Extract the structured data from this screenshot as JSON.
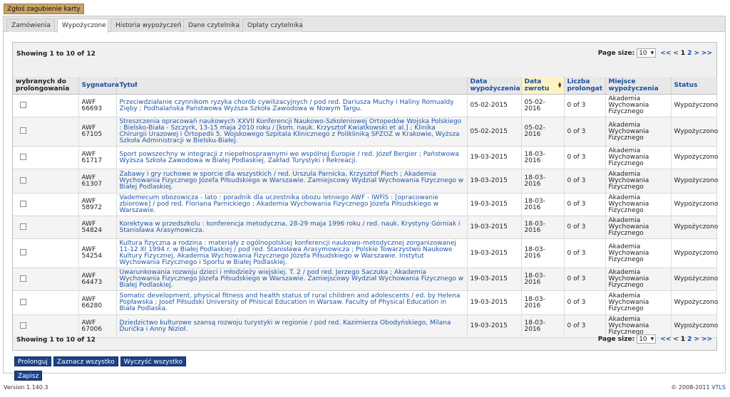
{
  "lost_card_label": "Zgłoś zagubienie karty",
  "tabs": [
    {
      "label": "Zamówienia"
    },
    {
      "label": "Wypożyczone"
    },
    {
      "label": "Historia wypożyczeń"
    },
    {
      "label": "Dane czytelnika"
    },
    {
      "label": "Opłaty czytelnika"
    }
  ],
  "active_tab": "Wypożyczone",
  "pager": {
    "showing": "Showing 1 to 10 of 12",
    "page_size_label": "Page size:",
    "page_size": "10",
    "first": "<<",
    "prev": "<",
    "page1": "1",
    "page2": "2",
    "next": ">",
    "last": ">>"
  },
  "columns": {
    "select": "wybranych do prolongowania",
    "signature": "Sygnatura",
    "title": "Tytuł",
    "loan_date": "Data wypożyczenia",
    "due_date": "Data zwrotu",
    "renewals": "Liczba prolongat",
    "location": "Miejsce wypożyczenia",
    "status": "Status"
  },
  "rows": [
    {
      "signature": "AWF 66693",
      "title": "Przeciwdziałanie czynnikom ryzyka chorób cywilizacyjnych / pod red. Dariusza Muchy i Haliny Romualdy Zięby ; Podhalańska Państwowa Wyższa Szkoła Zawodowa w Nowym Targu.",
      "loan_date": "05-02-2015",
      "due_date": "05-02-2016",
      "renewals": "0 of 3",
      "location": "Akademia Wychowania Fizycznego",
      "status": "Wypożyczono"
    },
    {
      "signature": "AWF 67105",
      "title": "Streszczenia opracowań naukowych XXVII Konferencji Naukowo-Szkoleniowej Ortopedów Wojska Polskiego : Bielsko-Biała - Szczyrk, 13-15 maja 2010 roku / [kom. nauk. Krzysztof Kwiatkowski et al.] ; Klinika Chirurgii Urazowej i Ortopedii 5. Wojskowego Szpitala Klinicznego z Polikliniką SPZOZ w Krakowie, Wyższa Szkoła Administracji w Bielsku-Białej.",
      "loan_date": "05-02-2015",
      "due_date": "05-02-2016",
      "renewals": "0 of 3",
      "location": "Akademia Wychowania Fizycznego",
      "status": "Wypożyczono"
    },
    {
      "signature": "AWF 61717",
      "title": "Sport powszechny w integracji z niepełnosprawnymi we wspólnej Europie / red. Józef Bergier ; Państwowa Wyższa Szkoła Zawodowa w Białej Podlaskiej. Zakład Turystyki i Rekreacji.",
      "loan_date": "19-03-2015",
      "due_date": "18-03-2016",
      "renewals": "0 of 3",
      "location": "Akademia Wychowania Fizycznego",
      "status": "Wypożyczono"
    },
    {
      "signature": "AWF 61307",
      "title": "Zabawy i gry ruchowe w sporcie dla wszystkich / red. Urszula Parnicka, Krzysztof Piech ; Akademia Wychowania Fizycznego Józefa Piłsudskiego w Warszawie. Zamiejscowy Wydział Wychowania Fizycznego w Białej Podlaskiej.",
      "loan_date": "19-03-2015",
      "due_date": "18-03-2016",
      "renewals": "0 of 3",
      "location": "Akademia Wychowania Fizycznego",
      "status": "Wypożyczono"
    },
    {
      "signature": "AWF 58972",
      "title": "Vademecum obozowicza - lato : poradnik dla uczestnika obozu letniego AWF - IWFiS : [opracowanie zbiorowe] / pod red. Floriana Parnickiego ; Akademia Wychowania Fizycznego Józefa Piłsudskiego w Warszawie.",
      "loan_date": "19-03-2015",
      "due_date": "18-03-2016",
      "renewals": "0 of 3",
      "location": "Akademia Wychowania Fizycznego",
      "status": "Wypożyczono"
    },
    {
      "signature": "AWF 54824",
      "title": "Korektywa w przedszkolu : konferencja metodyczna, 28-29 maja 1996 roku / red. nauk. Krystyny Górniak i Stanisława Arasymowicza.",
      "loan_date": "19-03-2015",
      "due_date": "18-03-2016",
      "renewals": "0 of 3",
      "location": "Akademia Wychowania Fizycznego",
      "status": "Wypożyczono"
    },
    {
      "signature": "AWF 54254",
      "title": "Kultura fizyczna a rodzina : materiały z ogólnopolskiej konferencji naukowo-metodycznej zorganizowanej 11-12 XI 1994 r. w Białej Podlaskiej / pod red. Stanisława Arasymowicza ; Polskie Towarzystwo Naukowe Kultury Fizycznej, Akademia Wychowania Fizycznego Józefa Piłsudskiego w Warszawie. Instytut Wychowania Fizycznego i Sportu w Białej Podlaskiej.",
      "loan_date": "19-03-2015",
      "due_date": "18-03-2016",
      "renewals": "0 of 3",
      "location": "Akademia Wychowania Fizycznego",
      "status": "Wypożyczono"
    },
    {
      "signature": "AWF 64473",
      "title": "Uwarunkowania rozwoju dzieci i młodzieży wiejskiej. T. 2 / pod red. Jerzego Saczuka ; Akademia Wychowania Fizycznego Józefa Piłsudskiego w Warszawie. Zamiejscowy Wydział Wychowania Fizycznego w Białej Podlaskiej.",
      "loan_date": "19-03-2015",
      "due_date": "18-03-2016",
      "renewals": "0 of 3",
      "location": "Akademia Wychowania Fizycznego",
      "status": "Wypożyczono"
    },
    {
      "signature": "AWF 66280",
      "title": "Somatic development, physical fitness and health status of rural children and adolescents / ed. by Helena Popławska ; Josef Piłsudski University of Phisical Education in Warsaw. Faculty of Physical Education in Biała Podlaska.",
      "loan_date": "19-03-2015",
      "due_date": "18-03-2016",
      "renewals": "0 of 3",
      "location": "Akademia Wychowania Fizycznego",
      "status": "Wypożyczono"
    },
    {
      "signature": "AWF 67006",
      "title": "Dziedzictwo kulturowe szansą rozwoju turystyki w regionie / pod red. Kazimierza Obodyńskiego, Milana Ďurička i Anny Nizioł.",
      "loan_date": "19-03-2015",
      "due_date": "18-03-2016",
      "renewals": "0 of 3",
      "location": "Akademia Wychowania Fizycznego",
      "status": "Wypożyczono"
    }
  ],
  "buttons": {
    "renew": "Prolonguj",
    "select_all": "Zaznacz wszystko",
    "clear_all": "Wyczyść wszystko",
    "save": "Zapisz"
  },
  "footer": {
    "version": "Version 1.140.3",
    "copyright": "© 2008-2011 ",
    "brand": "VTLS"
  }
}
